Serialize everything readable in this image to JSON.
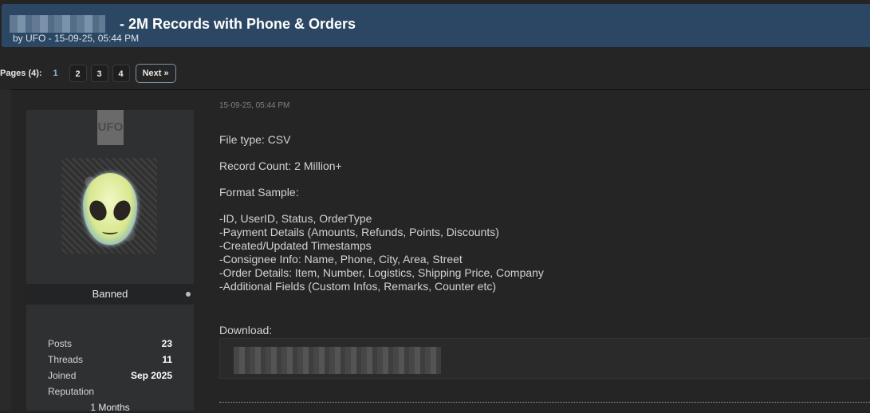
{
  "thread": {
    "title": "- 2M Records with Phone & Orders",
    "meta": "by UFO - 15-09-25, 05:44 PM"
  },
  "pagination": {
    "label": "Pages (4):",
    "current": "1",
    "pages": [
      "2",
      "3",
      "4"
    ],
    "next_label": "Next »"
  },
  "author": {
    "username": "UFO",
    "role": "Banned",
    "stats": {
      "posts_label": "Posts",
      "posts_value": "23",
      "threads_label": "Threads",
      "threads_value": "11",
      "joined_label": "Joined",
      "joined_value": "Sep 2025",
      "reputation_label": "Reputation",
      "reputation_value": "1 Months"
    }
  },
  "post": {
    "date": "15-09-25, 05:44 PM",
    "file_type": "File type: CSV",
    "record_count": "Record Count: 2 Million+",
    "format_sample_label": "Format Sample:",
    "format_lines": [
      "-ID, UserID, Status, OrderType",
      "-Payment Details (Amounts, Refunds, Points, Discounts)",
      "-Created/Updated Timestamps",
      "-Consignee Info: Name, Phone, City, Area, Street",
      "-Order Details: Item, Number, Logistics, Shipping Price, Company",
      "-Additional Fields (Custom Infos, Remarks, Counter etc)"
    ],
    "download_label": "Download:"
  },
  "colors": {
    "title_bar": "#2b4763",
    "page_background": "#252525",
    "author_panel": "#2e3032"
  }
}
